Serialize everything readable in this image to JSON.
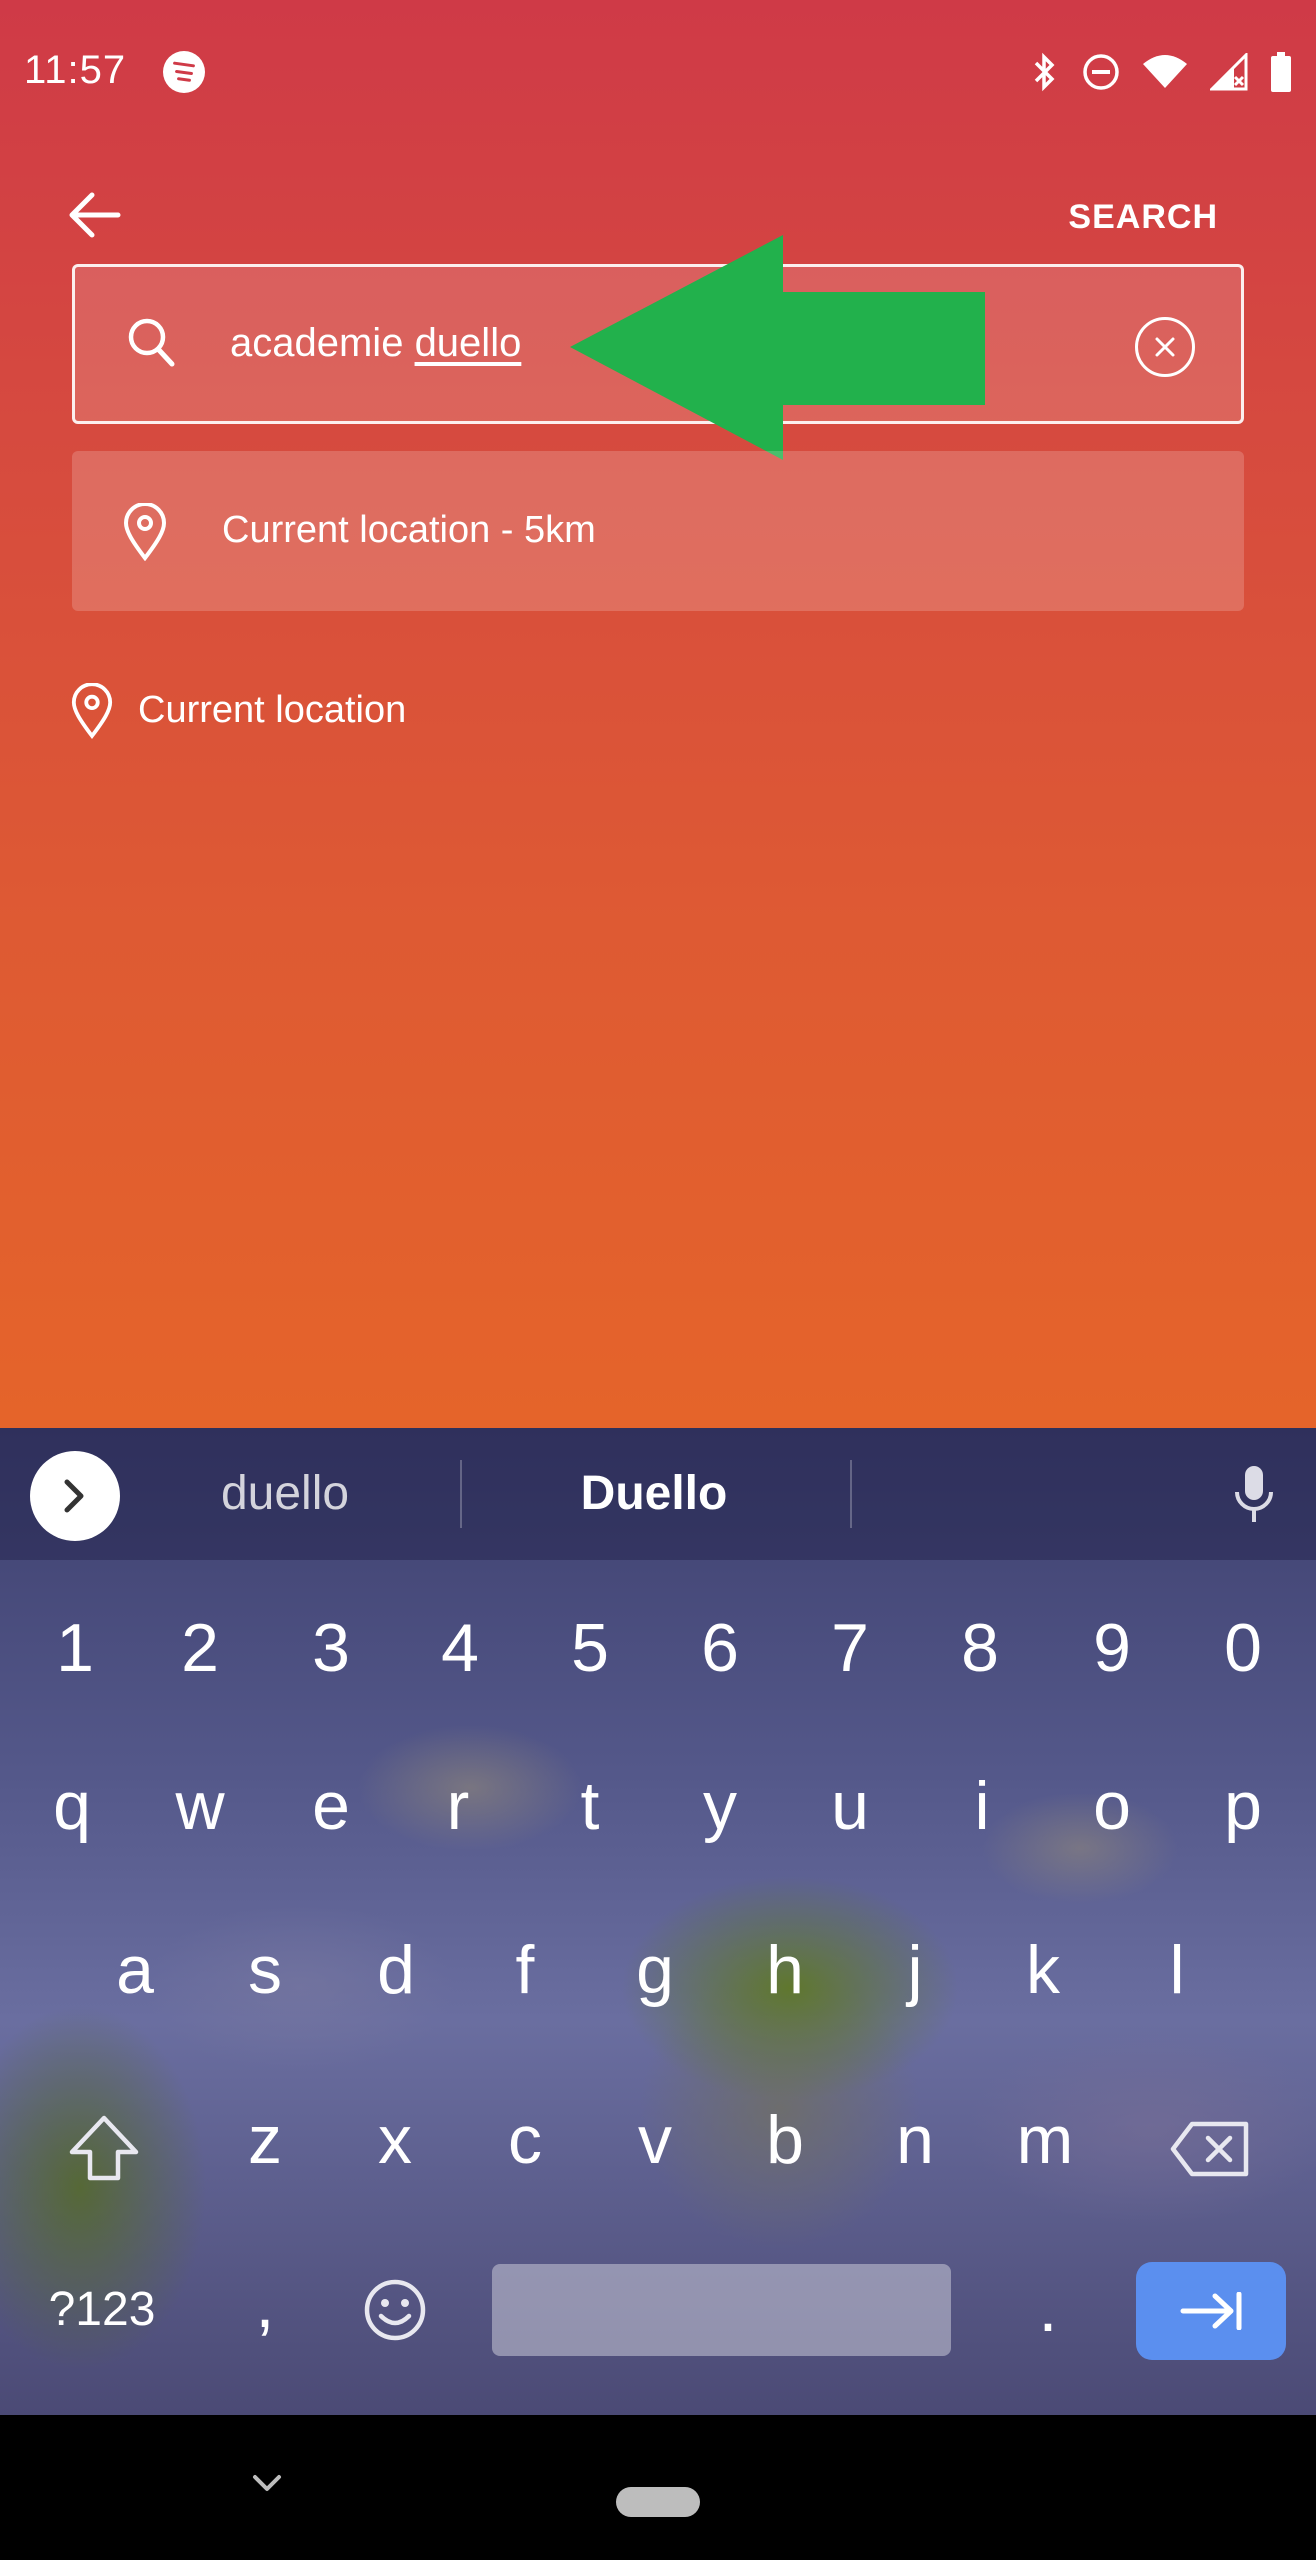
{
  "status_bar": {
    "time": "11:57"
  },
  "header": {
    "search_action": "SEARCH"
  },
  "search": {
    "query_prefix": "academie ",
    "query_composing": "duello"
  },
  "suggestion": {
    "label": "Current location - 5km"
  },
  "current_location": {
    "label": "Current location"
  },
  "keyboard": {
    "suggestions": [
      "duello",
      "Duello"
    ],
    "row_numbers": [
      "1",
      "2",
      "3",
      "4",
      "5",
      "6",
      "7",
      "8",
      "9",
      "0"
    ],
    "row_1": [
      "q",
      "w",
      "e",
      "r",
      "t",
      "y",
      "u",
      "i",
      "o",
      "p"
    ],
    "row_2": [
      "a",
      "s",
      "d",
      "f",
      "g",
      "h",
      "j",
      "k",
      "l"
    ],
    "row_3": [
      "z",
      "x",
      "c",
      "v",
      "b",
      "n",
      "m"
    ],
    "symbols_key": "?123",
    "comma_key": ",",
    "period_key": "."
  },
  "colors": {
    "accent_green": "#22b14c",
    "enter_key": "#5b8fef"
  },
  "icons": [
    "spotify-icon",
    "bluetooth-icon",
    "dnd-icon",
    "wifi-icon",
    "signal-icon",
    "battery-icon",
    "back-arrow-icon",
    "search-icon",
    "clear-icon",
    "location-pin-icon",
    "mic-icon",
    "emoji-icon",
    "shift-icon",
    "backspace-icon",
    "enter-icon"
  ]
}
